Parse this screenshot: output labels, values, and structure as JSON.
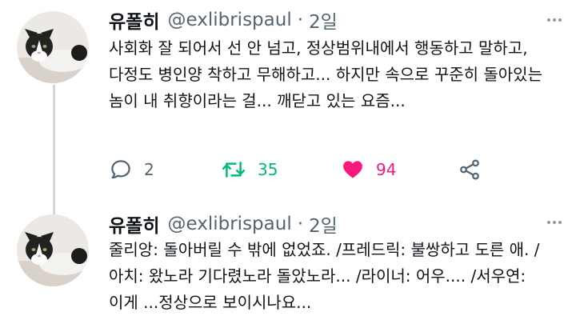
{
  "colors": {
    "name": "#0f1419",
    "secondary": "#536471",
    "retweet": "#00ba7c",
    "like": "#f91880",
    "thread_line": "#cfd9de"
  },
  "tweets": [
    {
      "author_name": "유폴히",
      "handle": "@exlibrispaul",
      "separator": "·",
      "time": "2일",
      "text": "사회화 잘 되어서 선 안 넘고, 정상범위내에서 행동하고 말하고, 다정도 병인양 착하고 무해하고... 하지만 속으로 꾸준히 돌아있는 놈이 내 취향이라는 걸... 깨닫고 있는 요즘...",
      "reply_count": "2",
      "retweet_count": "35",
      "like_count": "94",
      "icons": [
        "reply-icon",
        "retweet-icon",
        "like-icon",
        "share-icon",
        "more-icon"
      ]
    },
    {
      "author_name": "유폴히",
      "handle": "@exlibrispaul",
      "separator": "·",
      "time": "2일",
      "text": "줄리앙: 돌아버릴 수 밖에 없었죠. /프레드릭: 불쌍하고 도른 애. /아치: 왔노라 기다렸노라 돌았노라... /라이너: 어우.... /서우연: 이게 ...정상으로 보이시나요...",
      "icons": [
        "more-icon"
      ]
    }
  ]
}
